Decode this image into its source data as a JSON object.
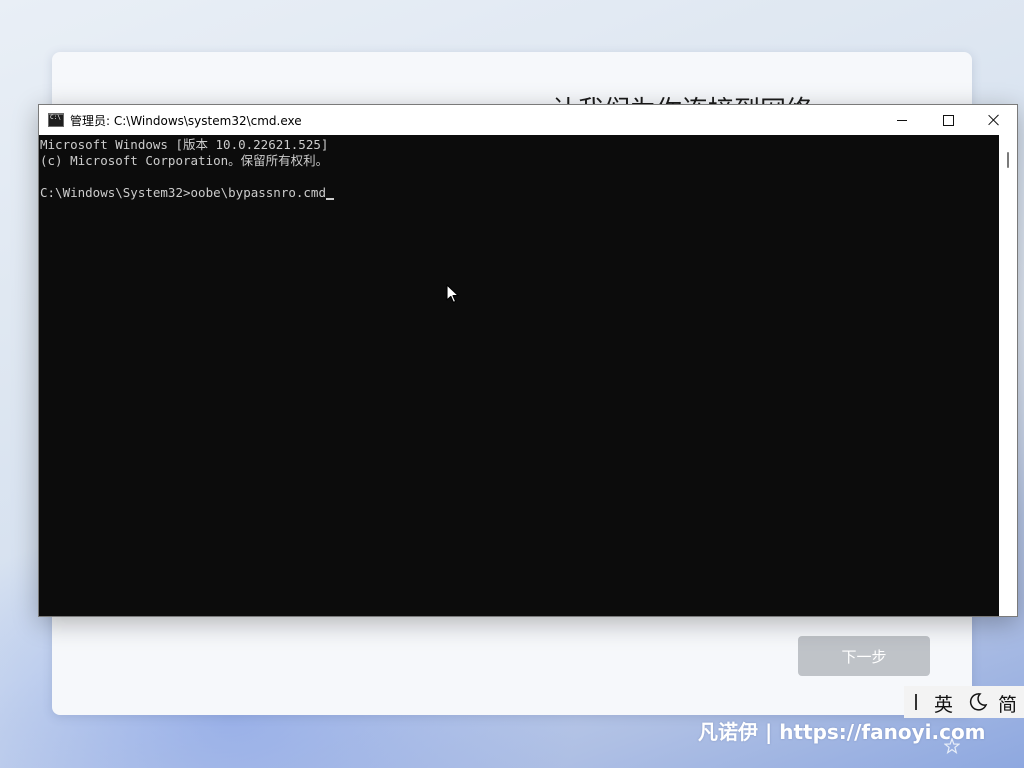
{
  "background_window": {
    "title": "让我们为你连接到网络",
    "next_button_label": "下一步"
  },
  "cmd_window": {
    "title": "管理员: C:\\Windows\\system32\\cmd.exe",
    "console_lines": [
      "Microsoft Windows [版本 10.0.22621.525]",
      "(c) Microsoft Corporation。保留所有权利。",
      "",
      "C:\\Windows\\System32>oobe\\bypassnro.cmd"
    ]
  },
  "ime_bar": {
    "language": "英",
    "mode_icon": "moon-icon",
    "script": "简"
  },
  "watermark": {
    "text": "凡诺伊 | https://fanoyi.com"
  },
  "colors": {
    "console_bg": "#0c0c0c",
    "console_fg": "#cccccc",
    "next_button_bg": "#bfc3c8"
  }
}
